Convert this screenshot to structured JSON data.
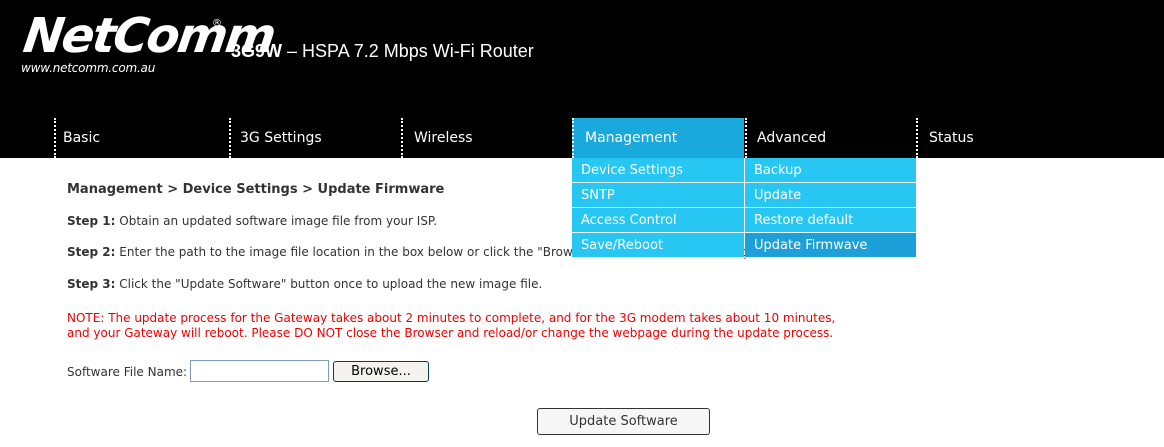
{
  "brand": {
    "logo": "NetComm",
    "registered": "®",
    "url": "www.netcomm.com.au",
    "model": "3G9W",
    "description": " – HSPA 7.2 Mbps Wi-Fi Router"
  },
  "nav": {
    "items": [
      "Basic",
      "3G Settings",
      "Wireless",
      "Management",
      "Advanced",
      "Status"
    ],
    "active": "Management"
  },
  "dropdown": {
    "col1": [
      "Device Settings",
      "SNTP",
      "Access Control",
      "Save/Reboot"
    ],
    "col2": [
      "Backup",
      "Update",
      "Restore default",
      "Update Firmwave"
    ],
    "active": "Update Firmwave"
  },
  "breadcrumb": "Management > Device Settings > Update Firmware",
  "steps": [
    {
      "label": "Step 1:",
      "text": " Obtain an updated software image file from your ISP."
    },
    {
      "label": "Step 2:",
      "text": " Enter the path to the image file location in the box below or click the \"Browse\" button to locate the image file."
    },
    {
      "label": "Step 3:",
      "text": " Click the \"Update Software\" button once to upload the new image file."
    }
  ],
  "note_line1": "NOTE: The update process for the Gateway takes about 2 minutes to complete, and for the 3G modem takes about 10 minutes,",
  "note_line2": "and your Gateway will reboot. Please DO NOT close the Browser and reload/or change the webpage during the update process.",
  "file_label": "Software File Name:",
  "file_value": "",
  "browse_label": "Browse...",
  "update_label": "Update Software",
  "colors": {
    "header_bg": "#000000",
    "nav_active": "#1aa9dc",
    "dropdown_bg": "#28c6f2",
    "dropdown_active": "#1d9fd9",
    "note": "#ee0000"
  }
}
